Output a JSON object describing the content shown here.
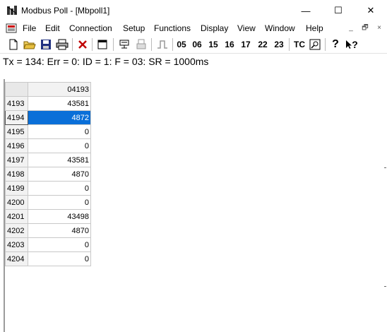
{
  "window": {
    "title": "Modbus Poll - [Mbpoll1]",
    "minimize_glyph": "—",
    "maximize_glyph": "☐",
    "close_glyph": "✕"
  },
  "menu": {
    "items": [
      "File",
      "Edit",
      "Connection",
      "Setup",
      "Functions",
      "Display",
      "View",
      "Window",
      "Help"
    ]
  },
  "mdi_controls": {
    "minimize": "_",
    "restore": "🗗",
    "close": "×"
  },
  "toolbar": {
    "function_codes": [
      "05",
      "06",
      "15",
      "16",
      "17",
      "22",
      "23"
    ],
    "tc_label": "TC",
    "help_glyph": "?",
    "context_help_glyph": "?"
  },
  "status_line": "Tx = 134: Err = 0: ID = 1: F = 03: SR = 1000ms",
  "grid": {
    "column_header": "04193",
    "selected_row": 4194,
    "rows": [
      {
        "address": "4193",
        "value": "43581"
      },
      {
        "address": "4194",
        "value": "4872"
      },
      {
        "address": "4195",
        "value": "0"
      },
      {
        "address": "4196",
        "value": "0"
      },
      {
        "address": "4197",
        "value": "43581"
      },
      {
        "address": "4198",
        "value": "4870"
      },
      {
        "address": "4199",
        "value": "0"
      },
      {
        "address": "4200",
        "value": "0"
      },
      {
        "address": "4201",
        "value": "43498"
      },
      {
        "address": "4202",
        "value": "4870"
      },
      {
        "address": "4203",
        "value": "0"
      },
      {
        "address": "4204",
        "value": "0"
      }
    ]
  }
}
